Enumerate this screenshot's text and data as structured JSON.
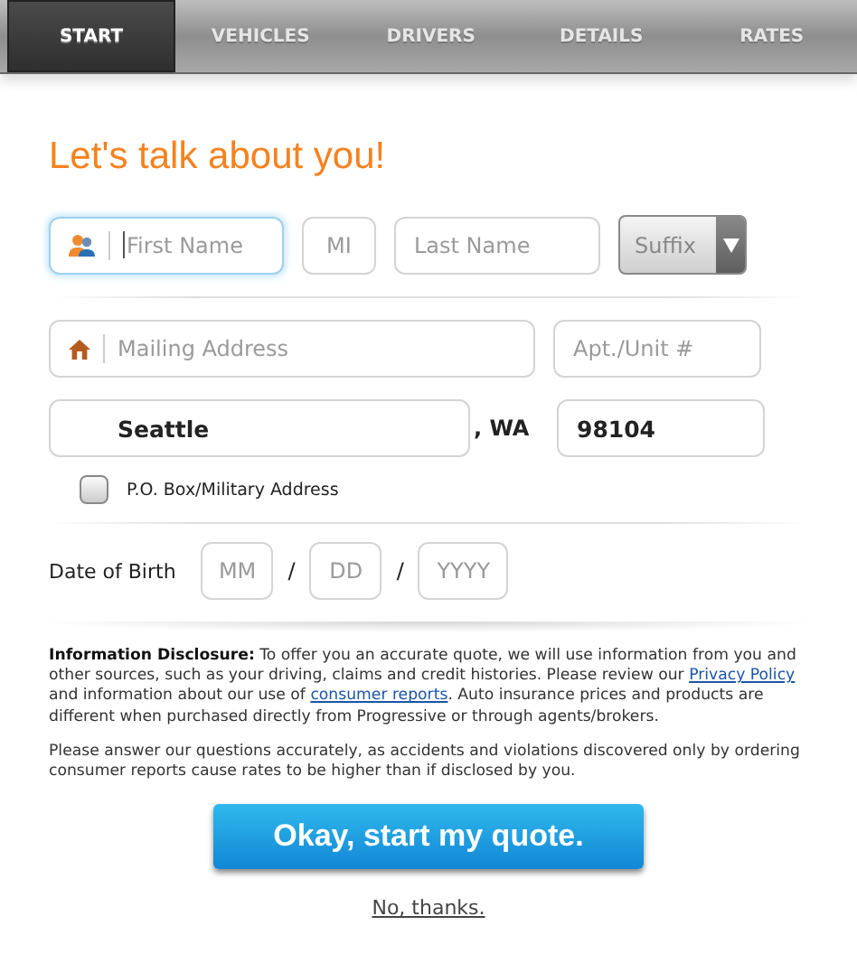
{
  "tabs": [
    {
      "label": "START",
      "selected": true
    },
    {
      "label": "VEHICLES",
      "selected": false
    },
    {
      "label": "DRIVERS",
      "selected": false
    },
    {
      "label": "DETAILS",
      "selected": false
    },
    {
      "label": "RATES",
      "selected": false
    }
  ],
  "heading": "Let's talk about you!",
  "name_row": {
    "first_name": {
      "placeholder": "First Name",
      "focused": true
    },
    "middle_initial": {
      "placeholder": "MI"
    },
    "last_name": {
      "placeholder": "Last Name"
    },
    "suffix": {
      "value": "Suffix"
    }
  },
  "address": {
    "mailing": {
      "placeholder": "Mailing Address"
    },
    "unit": {
      "placeholder": "Apt./Unit #"
    },
    "city": {
      "value": "Seattle"
    },
    "state": ", WA",
    "zip": {
      "value": "98104"
    },
    "po_box": {
      "label": "P.O. Box/Military Address",
      "checked": false
    }
  },
  "birth_date": {
    "label": "Date of Birth",
    "month": {
      "placeholder": "MM"
    },
    "separator_1": "/",
    "day": {
      "placeholder": "DD"
    },
    "separator_2": "/",
    "year": {
      "placeholder": "YYYY"
    }
  },
  "disclosure": [
    {
      "kind": "bold",
      "text": "Information Disclosure:"
    },
    {
      "kind": "text",
      "text": " To offer you an accurate quote, we will use information from you and other sources, such as your driving, claims and credit histories. Please review our "
    },
    {
      "kind": "link",
      "text": "Privacy Policy"
    },
    {
      "kind": "text",
      "text": " and information about our use of "
    },
    {
      "kind": "link",
      "text": "consumer reports"
    },
    {
      "kind": "text",
      "text": ". Auto insurance prices and products are different when purchased directly from Progressive or through agents/brokers."
    }
  ],
  "notice": "Please answer our questions accurately, as accidents and violations discovered only by ordering consumer reports cause rates to be higher than if disclosed by you.",
  "start_button": "Okay, start my quote.",
  "decline_link": "No, thanks."
}
